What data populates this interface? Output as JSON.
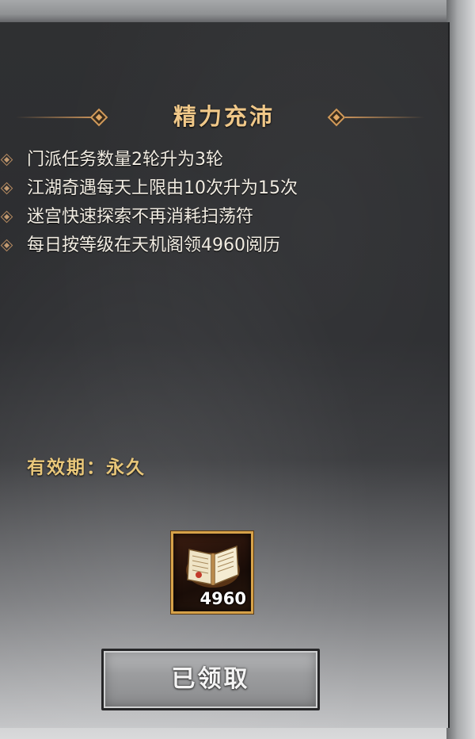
{
  "title": "精力充沛",
  "perks": [
    "门派任务数量2轮升为3轮",
    "江湖奇遇每天上限由10次升为15次",
    "迷宫快速探索不再消耗扫荡符",
    "每日按等级在天机阁领4960阅历"
  ],
  "validity": "有效期：永久",
  "reward": {
    "icon": "book-icon",
    "count": "4960"
  },
  "claim_button": "已领取",
  "colors": {
    "title": "#f0c889",
    "validity": "#e9c77a",
    "slot_border": "#d6a24a"
  }
}
